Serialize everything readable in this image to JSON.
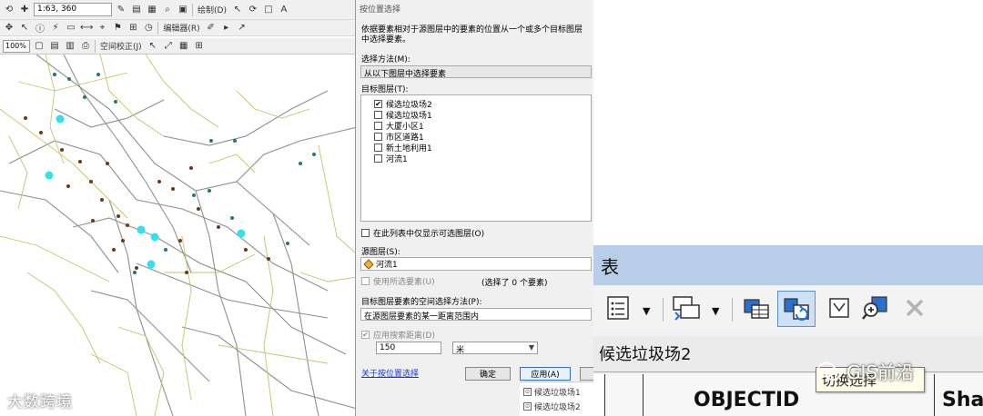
{
  "toolbar": {
    "scale": "1:63, 360",
    "draw_menu": "绘制(D)",
    "editor_menu": "编辑器(R)",
    "zoom": "100%",
    "georef_menu": "空间校正(J)"
  },
  "dialog": {
    "title": "按位置选择",
    "description": "依据要素相对于源图层中的要素的位置从一个或多个目标图层中选择要素。",
    "method_label": "选择方法(M):",
    "method_value": "从以下图层中选择要素",
    "target_label": "目标图层(T):",
    "target_layers": [
      {
        "name": "候选垃圾场2",
        "checked": true
      },
      {
        "name": "候选垃圾场1",
        "checked": false
      },
      {
        "name": "大厦小区1",
        "checked": false
      },
      {
        "name": "市区道路1",
        "checked": false
      },
      {
        "name": "新土地利用1",
        "checked": false
      },
      {
        "name": "河流1",
        "checked": false
      }
    ],
    "only_selectable_label": "在此列表中仅显示可选图层(O)",
    "source_label": "源图层(S):",
    "source_value": "河流1",
    "use_selected_label": "使用所选要素(U)",
    "selected_count": "(选择了 0 个要素)",
    "spatial_method_label": "目标图层要素的空间选择方法(P):",
    "spatial_method_value": "在源图层要素的某一距离范围内",
    "apply_distance_label": "应用搜索距离(D)",
    "distance_value": "150",
    "distance_unit": "米",
    "help_link": "关于按位置选择",
    "ok_label": "确定",
    "apply_label": "应用(A)",
    "toc_items": [
      "候选垃圾场1",
      "候选垃圾场2"
    ]
  },
  "table_window": {
    "title": "表",
    "layer_tab": "候选垃圾场2",
    "columns": [
      "OBJECTID",
      "Sha"
    ],
    "tooltip": "切换选择"
  },
  "watermarks": {
    "left": "大数跨境",
    "right": "GIS前沿"
  },
  "colors": {
    "river_point": "#33e0f0",
    "site_point_brown": "#6b3a1e",
    "site_point_teal": "#1c7b73",
    "road_yellow": "#c9c26a",
    "road_gray": "#8f8f8f",
    "table_title_bar": "#b7cde8"
  }
}
